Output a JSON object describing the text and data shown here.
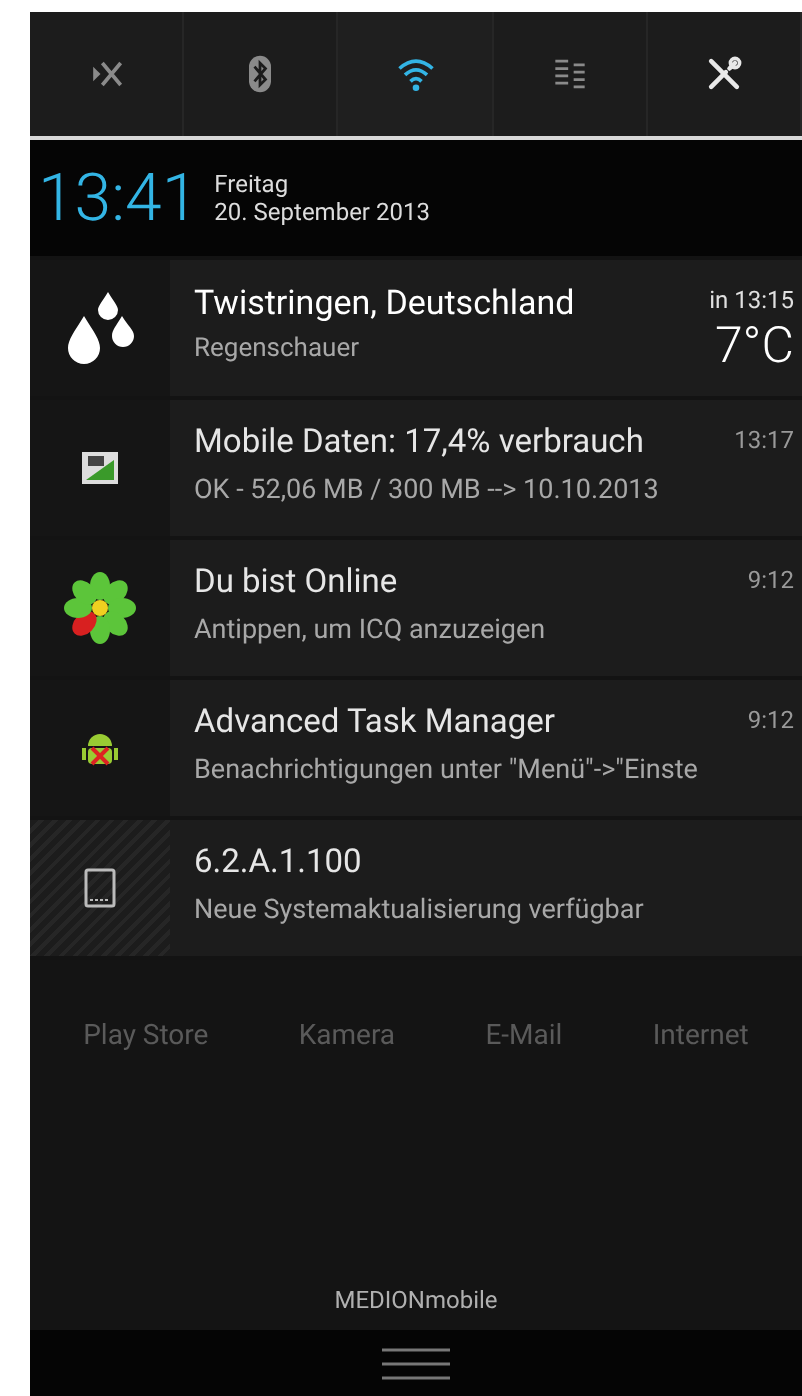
{
  "quick_settings": [
    {
      "kind": "airplane",
      "on": false
    },
    {
      "kind": "bluetooth",
      "on": false
    },
    {
      "kind": "wifi",
      "on": true
    },
    {
      "kind": "sync",
      "on": false
    },
    {
      "kind": "settings",
      "on": false
    }
  ],
  "clock": {
    "time": "13:41",
    "weekday": "Freitag",
    "date": "20. September 2013"
  },
  "notifications": [
    {
      "kind": "weather",
      "title": "Twistringen, Deutschland",
      "text": "Regenschauer",
      "time": "in 13:15",
      "temperature": "7°C"
    },
    {
      "kind": "data",
      "title": "Mobile Daten: 17,4% verbrauch",
      "text": "OK - 52,06 MB / 300 MB --> 10.10.2013",
      "time": "13:17"
    },
    {
      "kind": "icq",
      "title": "Du bist Online",
      "text": "Antippen, um ICQ anzuzeigen",
      "time": "9:12"
    },
    {
      "kind": "taskmanager",
      "title": "Advanced Task Manager",
      "text": "Benachrichtigungen unter \"Menü\"->\"Einste",
      "time": "9:12"
    },
    {
      "kind": "update",
      "title": "6.2.A.1.100",
      "text": "Neue Systemaktualisierung verfügbar"
    }
  ],
  "home_shortcuts": [
    "Play Store",
    "Kamera",
    "E-Mail",
    "Internet"
  ],
  "carrier": "MEDIONmobile"
}
